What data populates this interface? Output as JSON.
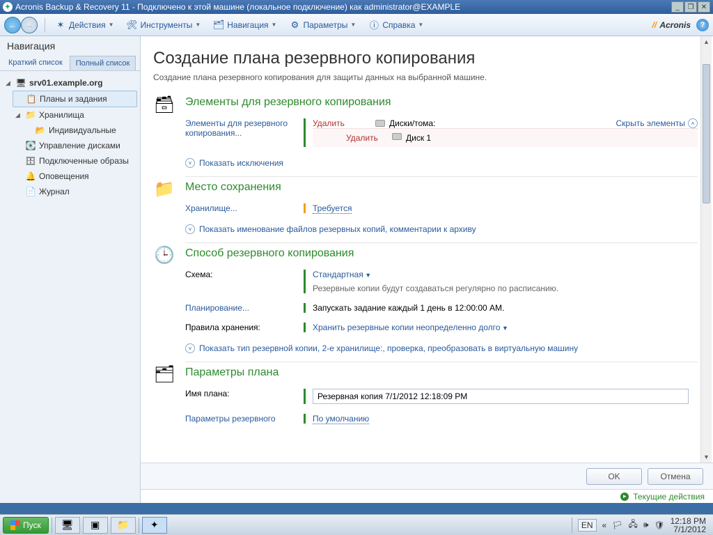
{
  "window": {
    "title": "Acronis Backup & Recovery 11 - Подключено к этой машине (локальное подключение) как administrator@EXAMPLE"
  },
  "toolbar": {
    "actions": "Действия",
    "tools": "Инструменты",
    "navigation": "Навигация",
    "options": "Параметры",
    "help": "Справка",
    "brand": "Acronis"
  },
  "sidebar": {
    "title": "Навигация",
    "tabs": {
      "short": "Краткий список",
      "full": "Полный список"
    },
    "root": "srv01.example.org",
    "nodes": {
      "plans": "Планы и задания",
      "vaults": "Хранилища",
      "individual": "Индивидуальные",
      "disk_mgmt": "Управление дисками",
      "mounted": "Подключенные образы",
      "alerts": "Оповещения",
      "log": "Журнал"
    }
  },
  "page": {
    "title": "Создание плана резервного копирования",
    "subtitle": "Создание плана резервного копирования для защиты данных на выбранной машине."
  },
  "sec_items": {
    "heading": "Элементы для резервного копирования",
    "items_link": "Элементы для резервного копирования...",
    "delete": "Удалить",
    "disks_volumes": "Диски/тома:",
    "hide": "Скрыть элементы",
    "disk1": "Диск 1",
    "show_excl": "Показать исключения"
  },
  "sec_location": {
    "heading": "Место сохранения",
    "vault_link": "Хранилище...",
    "required": "Требуется",
    "show_naming": "Показать именование файлов резервных копий, комментарии к архиву"
  },
  "sec_method": {
    "heading": "Способ резервного копирования",
    "scheme_label": "Схема:",
    "scheme_value": "Стандартная",
    "scheme_desc": "Резервные копии будут создаваться регулярно по расписанию.",
    "schedule_link": "Планирование...",
    "schedule_value": "Запускать задание каждый 1 день в 12:00:00 AM.",
    "retention_label": "Правила хранения:",
    "retention_value": "Хранить резервные копии неопределенно долго",
    "show_type": "Показать тип резервной копии, 2-е хранилище:, проверка, преобразовать в виртуальную машину"
  },
  "sec_plan": {
    "heading": "Параметры плана",
    "name_label": "Имя плана:",
    "name_value": "Резервная копия 7/1/2012 12:18:09 PM",
    "backup_params": "Параметры резервного",
    "default": "По умолчанию"
  },
  "footer": {
    "ok": "OK",
    "cancel": "Отмена"
  },
  "status": {
    "current_tasks": "Текущие действия"
  },
  "taskbar": {
    "start": "Пуск",
    "lang": "EN",
    "time": "12:18 PM",
    "date": "7/1/2012"
  }
}
